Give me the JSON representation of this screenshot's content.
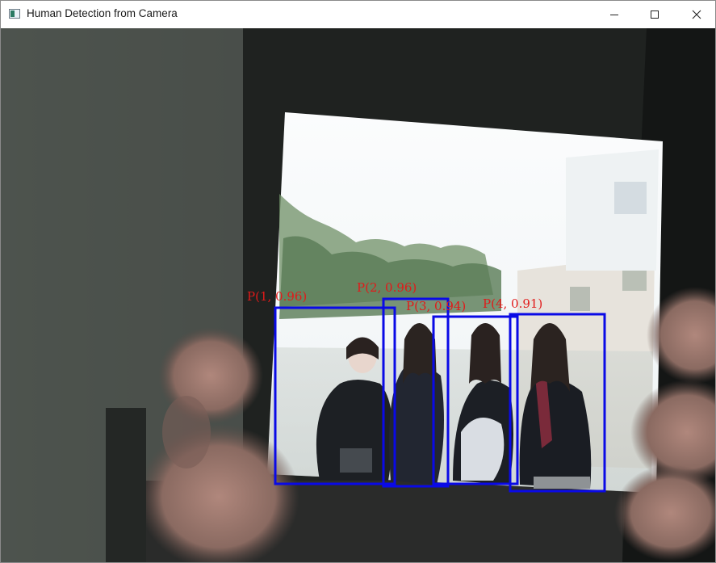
{
  "window": {
    "title": "Human Detection from Camera",
    "controls": {
      "minimize": "minimize-icon",
      "maximize": "maximize-icon",
      "close": "close-icon"
    }
  },
  "colors": {
    "box": "#0a0ae6",
    "label": "#e11a1a",
    "titlebar": "#ffffff"
  },
  "detections": [
    {
      "label": "P(1, 0.96)"
    },
    {
      "label": "P(2, 0.96)"
    },
    {
      "label": "P(3, 0.94)"
    },
    {
      "label": "P(4, 0.91)"
    }
  ]
}
